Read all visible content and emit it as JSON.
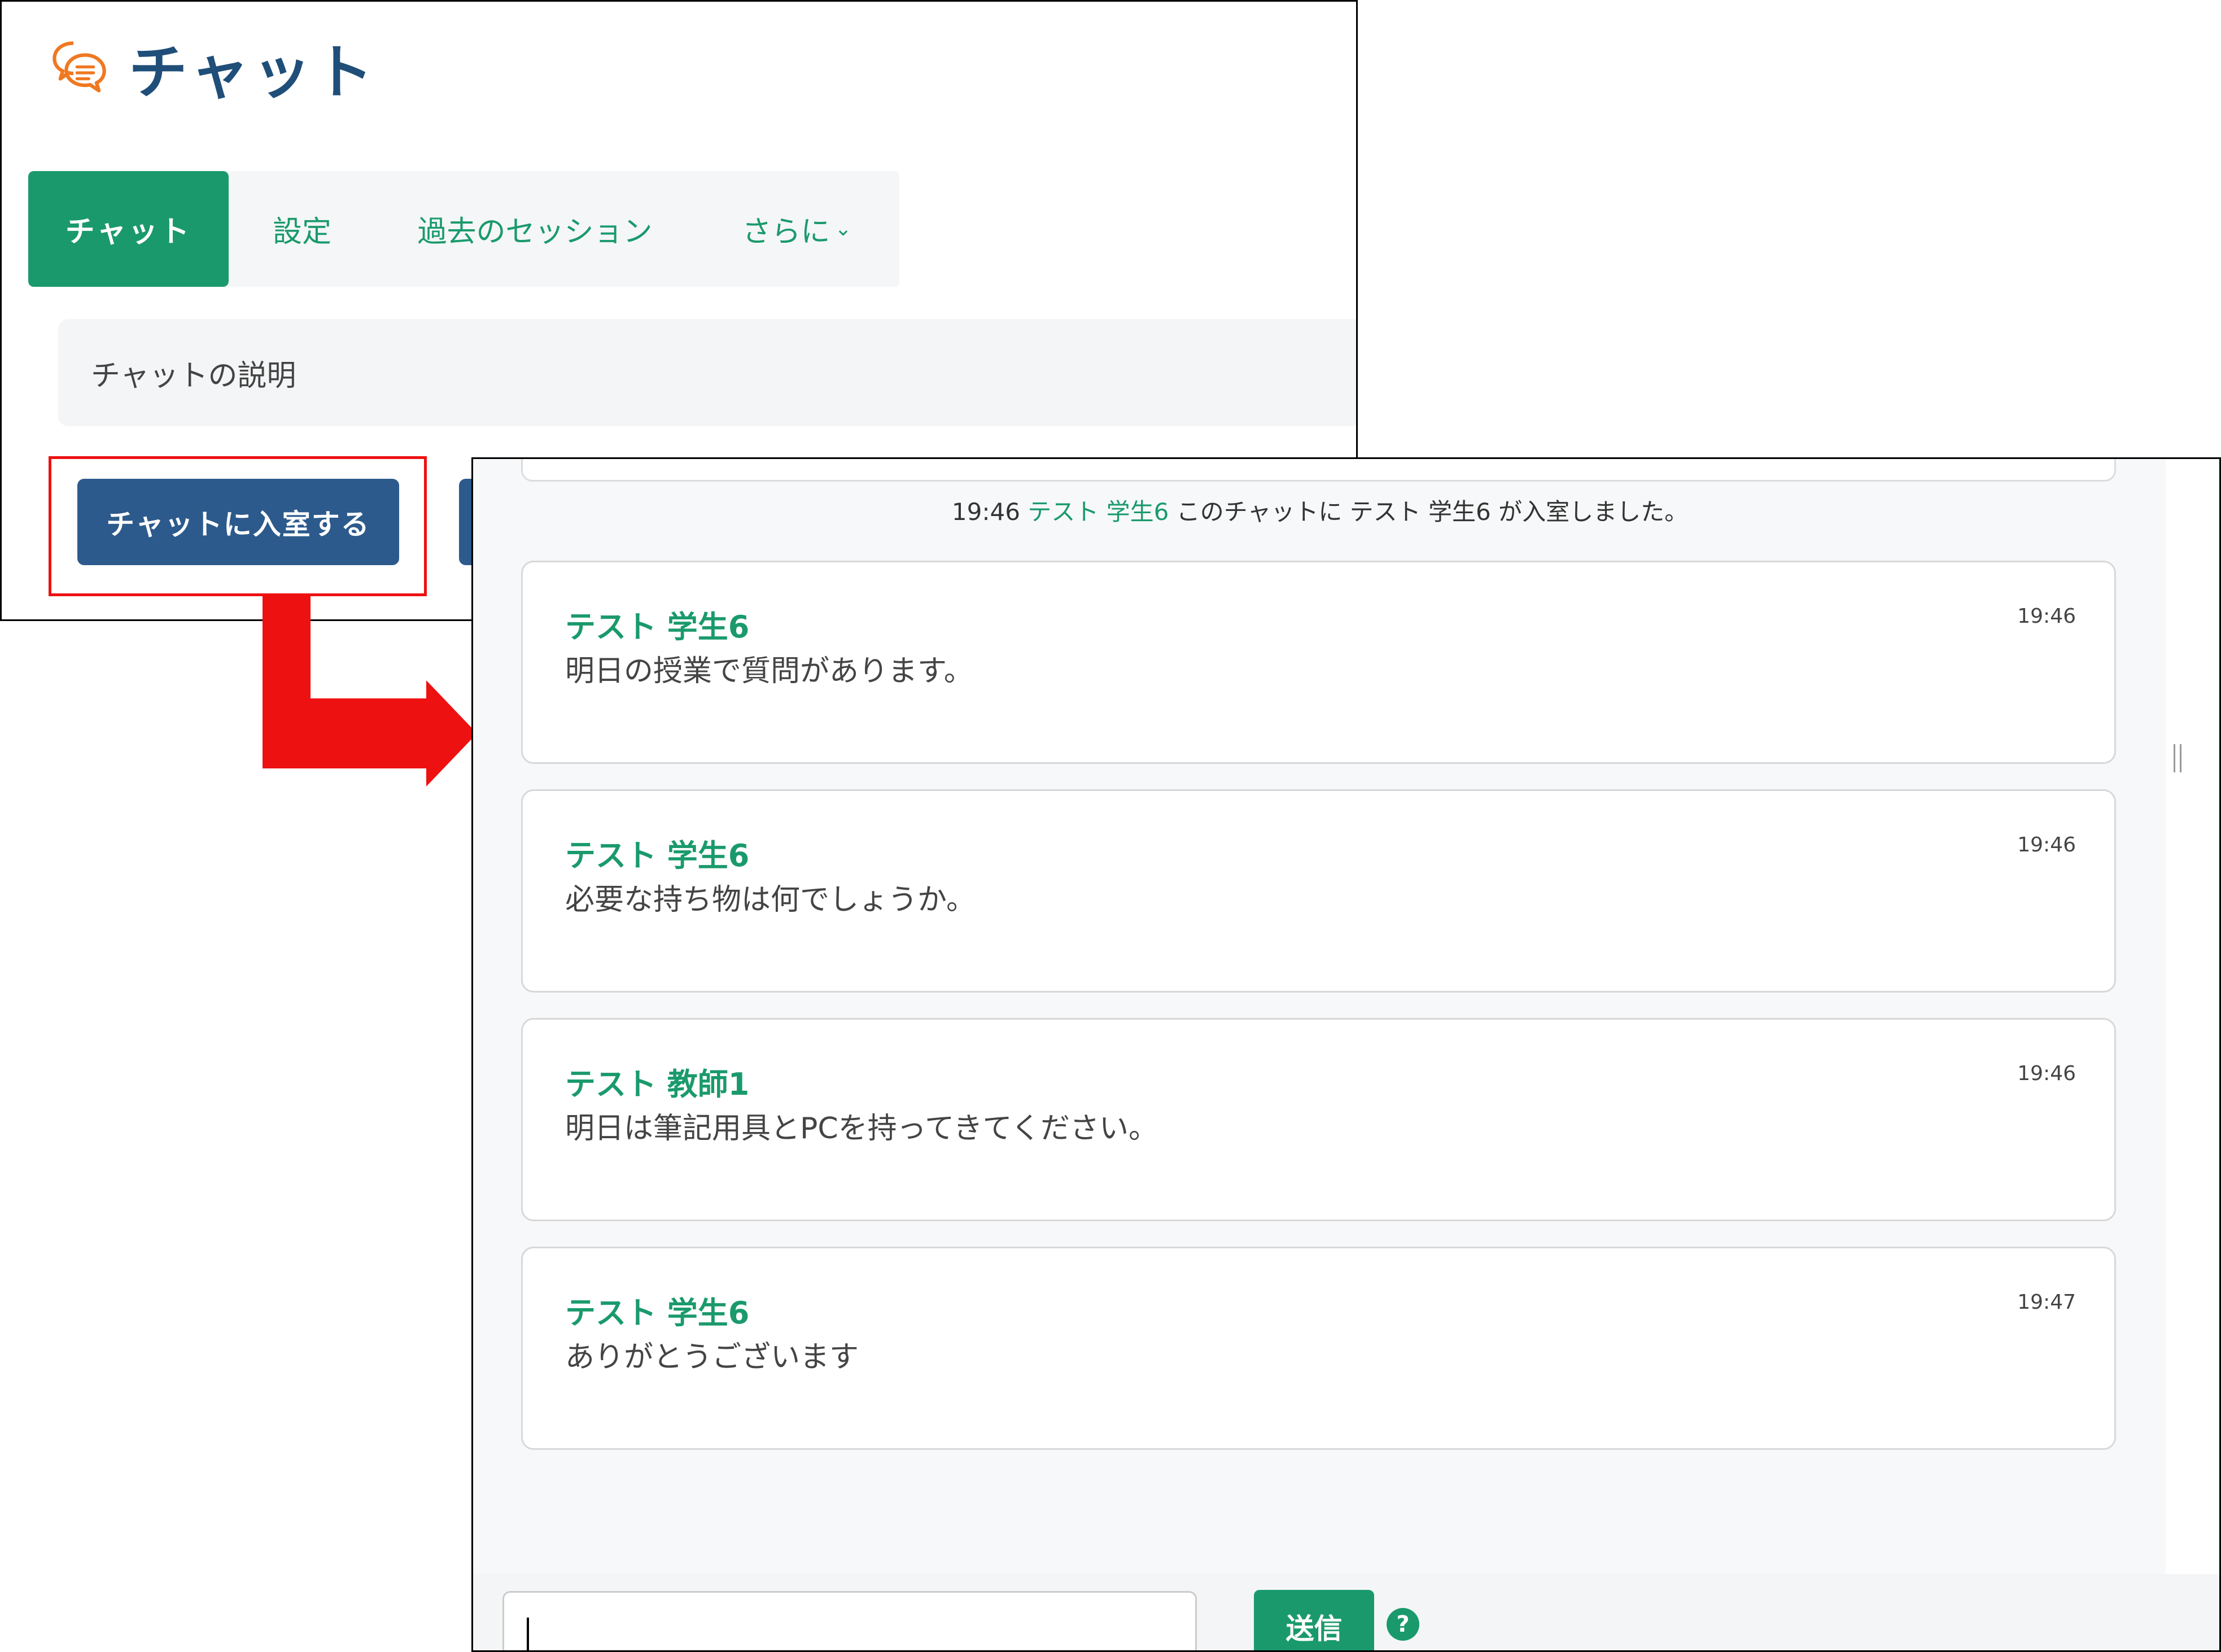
{
  "colors": {
    "primary_green": "#1a9a6c",
    "primary_blue": "#2d5a8c",
    "title_blue": "#1f4e79",
    "icon_orange": "#f07820",
    "highlight_red": "#ee1111"
  },
  "activity": {
    "icon": "chat-bubbles-icon",
    "title": "チャット",
    "tabs": [
      {
        "label": "チャット",
        "active": true
      },
      {
        "label": "設定",
        "active": false
      },
      {
        "label": "過去のセッション",
        "active": false
      },
      {
        "label": "さらに",
        "active": false,
        "icon": "chevron-down-icon"
      }
    ],
    "description": "チャットの説明",
    "enter_button": "チャットに入室する"
  },
  "chat": {
    "system_message": {
      "time": "19:46",
      "name": "テスト 学生6",
      "text": "このチャットに テスト 学生6 が入室しました。"
    },
    "messages": [
      {
        "author": "テスト 学生6",
        "time": "19:46",
        "text": "明日の授業で質問があります。"
      },
      {
        "author": "テスト 学生6",
        "time": "19:46",
        "text": "必要な持ち物は何でしょうか。"
      },
      {
        "author": "テスト 教師1",
        "time": "19:46",
        "text": "明日は筆記用具とPCを持ってきてください。"
      },
      {
        "author": "テスト 学生6",
        "time": "19:47",
        "text": "ありがとうございます"
      }
    ],
    "input_value": "",
    "send_button": "送信",
    "help_icon": "?"
  }
}
